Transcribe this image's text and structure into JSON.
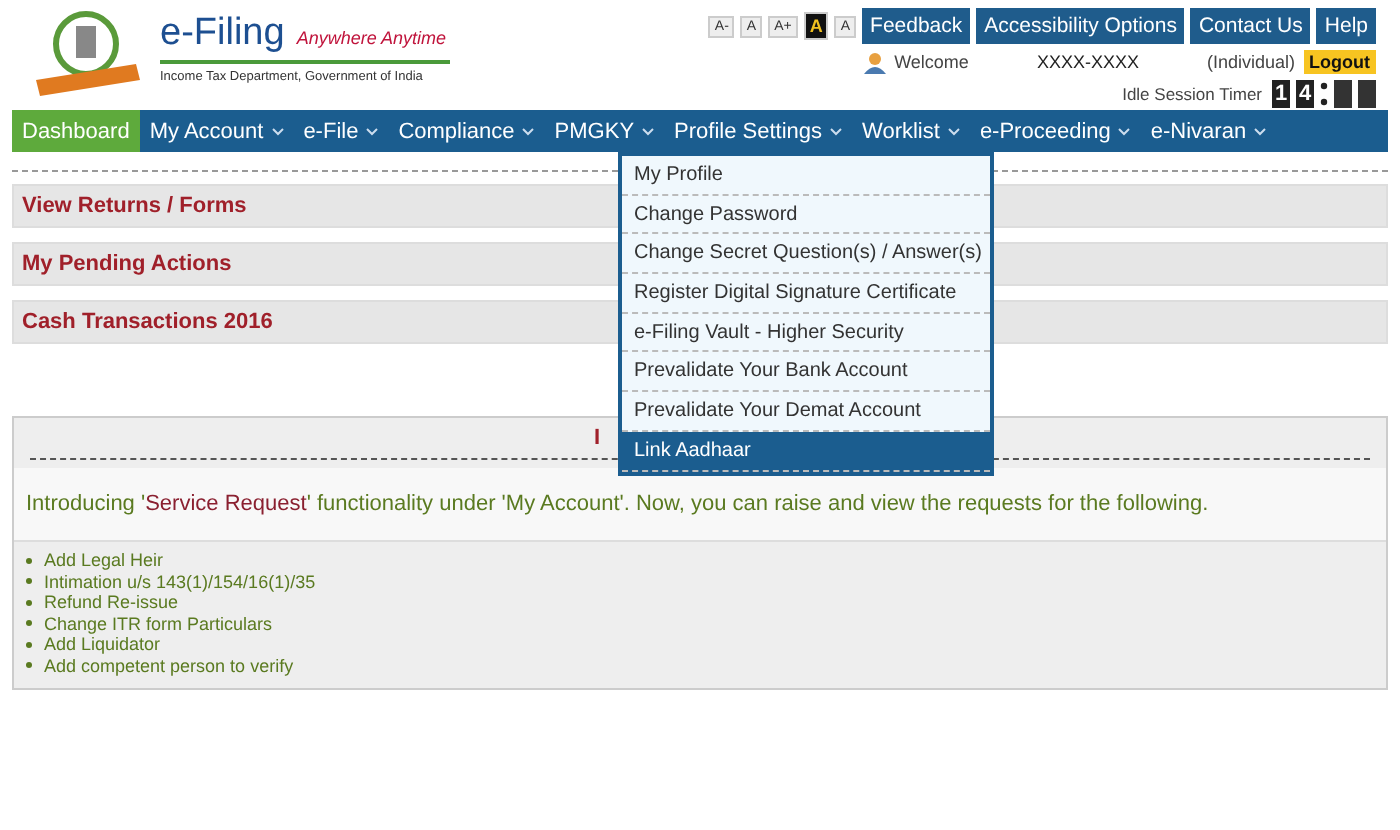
{
  "header": {
    "brand": "e-Filing",
    "tagline": "Anywhere Anytime",
    "subtitle": "Income Tax Department, Government of India"
  },
  "font_sizes": [
    {
      "label": "A-",
      "selected": false
    },
    {
      "label": "A",
      "selected": false
    },
    {
      "label": "A+",
      "selected": false
    },
    {
      "label": "A",
      "selected": true
    },
    {
      "label": "A",
      "selected": false
    }
  ],
  "top_links": [
    "Feedback",
    "Accessibility Options",
    "Contact Us",
    "Help"
  ],
  "user": {
    "welcome": "Welcome",
    "id": "XXXX-XXXX",
    "type": "(Individual)",
    "logout": "Logout"
  },
  "timer": {
    "label": "Idle Session Timer",
    "digits": [
      "1",
      "4"
    ]
  },
  "nav": [
    {
      "label": "Dashboard",
      "selected": true,
      "caret": false
    },
    {
      "label": "My Account",
      "selected": false,
      "caret": true
    },
    {
      "label": "e-File",
      "selected": false,
      "caret": true
    },
    {
      "label": "Compliance",
      "selected": false,
      "caret": true
    },
    {
      "label": "PMGKY",
      "selected": false,
      "caret": true
    },
    {
      "label": "Profile Settings",
      "selected": false,
      "caret": true
    },
    {
      "label": "Worklist",
      "selected": false,
      "caret": true
    },
    {
      "label": "e-Proceeding",
      "selected": false,
      "caret": true
    },
    {
      "label": "e-Nivaran",
      "selected": false,
      "caret": true
    }
  ],
  "dropdown": [
    {
      "label": "My Profile",
      "selected": false
    },
    {
      "label": "Change Password",
      "selected": false
    },
    {
      "label": "Change Secret Question(s) / Answer(s)",
      "selected": false
    },
    {
      "label": "Register Digital Signature Certificate",
      "selected": false
    },
    {
      "label": "e-Filing Vault - Higher Security",
      "selected": false
    },
    {
      "label": "Prevalidate Your Bank Account",
      "selected": false
    },
    {
      "label": "Prevalidate Your Demat Account",
      "selected": false
    },
    {
      "label": "Link Aadhaar",
      "selected": true
    }
  ],
  "sections": [
    "View Returns / Forms",
    "My Pending Actions",
    "Cash Transactions 2016"
  ],
  "notice": {
    "heading": "I",
    "intro": [
      {
        "text": "Introducing '",
        "highlight": false
      },
      {
        "text": "Service Request",
        "highlight": true
      },
      {
        "text": "' functionality under 'My Account'. Now, you can raise and view the requests for the following.",
        "highlight": false
      }
    ],
    "items": [
      "Add Legal Heir",
      "Intimation u/s 143(1)/154/16(1)/35",
      "Refund Re-issue",
      "Change ITR form Particulars",
      "Add Liquidator",
      "Add competent person to verify"
    ]
  }
}
